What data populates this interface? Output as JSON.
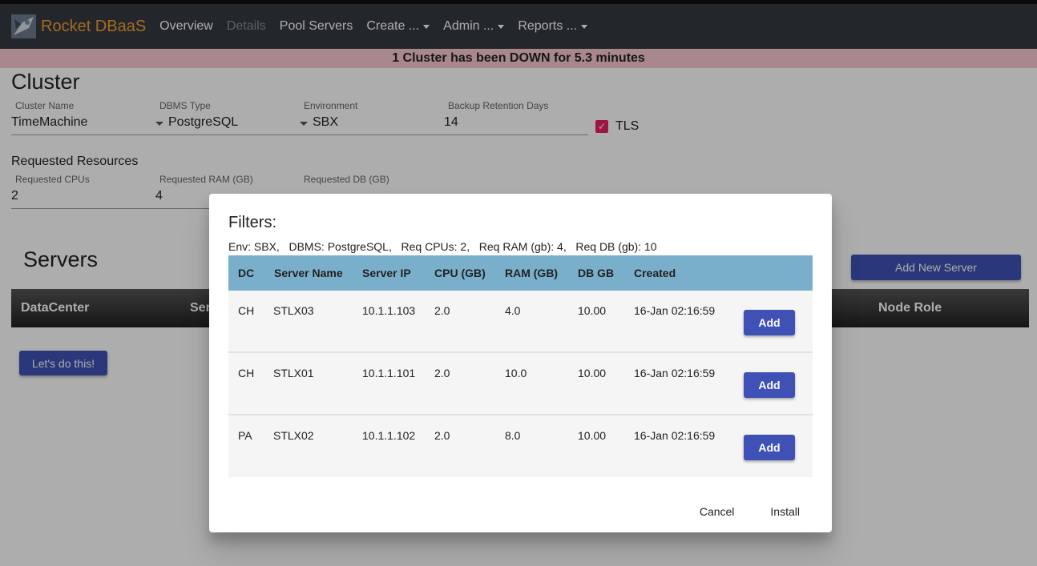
{
  "navbar": {
    "brand": "Rocket DBaaS",
    "items": [
      {
        "label": "Overview",
        "disabled": false,
        "dropdown": false
      },
      {
        "label": "Details",
        "disabled": true,
        "dropdown": false
      },
      {
        "label": "Pool Servers",
        "disabled": false,
        "dropdown": false
      },
      {
        "label": "Create ...",
        "disabled": false,
        "dropdown": true
      },
      {
        "label": "Admin ...",
        "disabled": false,
        "dropdown": true
      },
      {
        "label": "Reports ...",
        "disabled": false,
        "dropdown": true
      }
    ]
  },
  "alert": {
    "text": "1 Cluster has been DOWN for 5.3 minutes",
    "color": "#f8c9d0"
  },
  "cluster": {
    "title": "Cluster",
    "name_label": "Cluster Name",
    "name_value": "TimeMachine",
    "dbms_label": "DBMS Type",
    "dbms_value": "PostgreSQL",
    "env_label": "Environment",
    "env_value": "SBX",
    "backup_label": "Backup Retention Days",
    "backup_value": "14",
    "tls_label": "TLS",
    "tls_checked": true
  },
  "resources": {
    "title": "Requested Resources",
    "cpu_label": "Requested CPUs",
    "cpu_value": "2",
    "ram_label": "Requested RAM (GB)",
    "ram_value": "4",
    "db_label": "Requested DB (GB)"
  },
  "servers": {
    "title": "Servers",
    "add_button": "Add New Server",
    "columns": {
      "datacenter": "DataCenter",
      "server": "Ser",
      "node_role": "Node Role"
    },
    "lets_do_button": "Let's do this!"
  },
  "modal": {
    "title": "Filters:",
    "filters": "Env: SBX,   DBMS: PostgreSQL,   Req CPUs: 2,   Req RAM (gb): 4,   Req DB (gb): 10",
    "headers": [
      "DC",
      "Server Name",
      "Server IP",
      "CPU (GB)",
      "RAM (GB)",
      "DB GB",
      "Created"
    ],
    "rows": [
      {
        "dc": "CH",
        "name": "STLX03",
        "ip": "10.1.1.103",
        "cpu": "2.0",
        "ram": "4.0",
        "db": "10.00",
        "created": "16-Jan 02:16:59",
        "action": "Add"
      },
      {
        "dc": "CH",
        "name": "STLX01",
        "ip": "10.1.1.101",
        "cpu": "2.0",
        "ram": "10.0",
        "db": "10.00",
        "created": "16-Jan 02:16:59",
        "action": "Add"
      },
      {
        "dc": "PA",
        "name": "STLX02",
        "ip": "10.1.1.102",
        "cpu": "2.0",
        "ram": "8.0",
        "db": "10.00",
        "created": "16-Jan 02:16:59",
        "action": "Add"
      }
    ],
    "cancel": "Cancel",
    "install": "Install",
    "header_color": "#7aafcb"
  },
  "colors": {
    "primary": "#3f51b5",
    "brand": "#f39c34",
    "navbar": "#343a40",
    "checkbox": "#e91e63"
  }
}
